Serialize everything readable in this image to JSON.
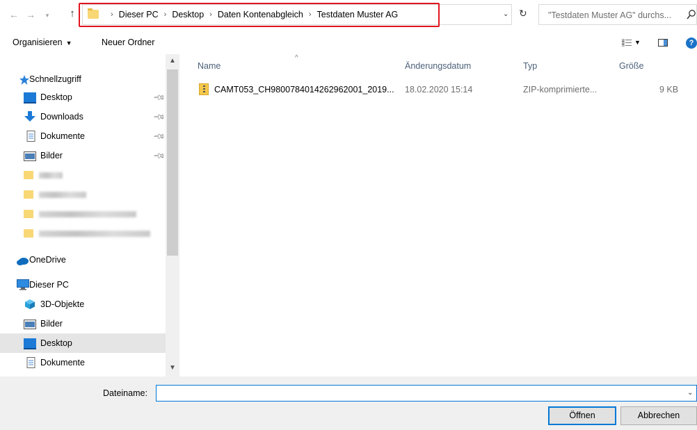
{
  "address": {
    "crumbs": [
      "Dieser PC",
      "Desktop",
      "Daten Kontenabgleich",
      "Testdaten Muster AG"
    ],
    "search_placeholder": "\"Testdaten Muster AG\" durchs..."
  },
  "toolbar": {
    "organize_label": "Organisieren",
    "new_folder_label": "Neuer Ordner"
  },
  "sidebar": {
    "quick_access": "Schnellzugriff",
    "pinned": [
      "Desktop",
      "Downloads",
      "Dokumente",
      "Bilder"
    ],
    "onedrive": "OneDrive",
    "this_pc": "Dieser PC",
    "pc_items": [
      "3D-Objekte",
      "Bilder",
      "Desktop",
      "Dokumente"
    ],
    "selected": "Desktop"
  },
  "columns": {
    "name": "Name",
    "date": "Änderungsdatum",
    "type": "Typ",
    "size": "Größe"
  },
  "files": [
    {
      "name": "CAMT053_CH9800784014262962001_2019...",
      "date": "18.02.2020 15:14",
      "type": "ZIP-komprimierte...",
      "size": "9 KB"
    }
  ],
  "bottom": {
    "filename_label": "Dateiname:",
    "filename_value": "",
    "open_label": "Öffnen",
    "cancel_label": "Abbrechen"
  },
  "colors": {
    "highlight": "#e0141e",
    "accent": "#0078d7",
    "selection": "#e5e5e5",
    "header_text": "#4c607a"
  }
}
